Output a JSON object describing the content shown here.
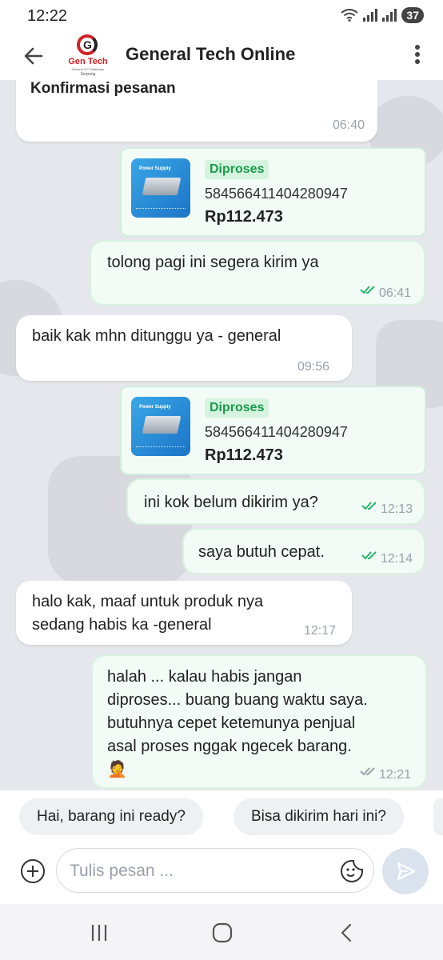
{
  "status": {
    "time": "12:22",
    "battery": "37"
  },
  "header": {
    "title": "General Tech Online",
    "logo": {
      "name": "Gen Tech",
      "tagline": "General ICT Distributor",
      "location": "Serpong",
      "mark": "G"
    }
  },
  "messages": [
    {
      "type": "in",
      "text": "Konfirmasi pesanan",
      "time": "06:40"
    },
    {
      "type": "product",
      "status": "Diproses",
      "order_id": "584566411404280947",
      "price": "Rp112.473",
      "thumb_title": "Power Supply"
    },
    {
      "type": "out",
      "text": "tolong pagi ini segera kirim ya",
      "time": "06:41",
      "read": true
    },
    {
      "type": "in",
      "text": "baik kak mhn ditunggu ya - general",
      "time": "09:56"
    },
    {
      "type": "product",
      "status": "Diproses",
      "order_id": "584566411404280947",
      "price": "Rp112.473",
      "thumb_title": "Power Supply"
    },
    {
      "type": "out",
      "text": "ini kok belum dikirim ya?",
      "time": "12:13",
      "read": true
    },
    {
      "type": "out",
      "text": "saya butuh cepat.",
      "time": "12:14",
      "read": true
    },
    {
      "type": "in",
      "line1": "halo kak, maaf untuk produk nya",
      "line2": "sedang habis ka -general",
      "time": "12:17"
    },
    {
      "type": "out",
      "line1": "halah ... kalau habis jangan",
      "line2": "diproses... buang buang waktu saya.",
      "line3": "butuhnya cepet ketemunya penjual",
      "line4": "asal proses nggak ngecek barang.",
      "emoji": "🤦",
      "time": "12:21",
      "read": false
    }
  ],
  "quick_replies": [
    "Hai, barang ini ready?",
    "Bisa dikirim hari ini?"
  ],
  "composer": {
    "placeholder": "Tulis pesan ..."
  },
  "colors": {
    "accent_green": "#1a9b4b",
    "read_tick": "#2bb673",
    "unread_tick": "#9aa1ab",
    "brand_red": "#d32027"
  },
  "icons": {
    "back": "arrow-left-icon",
    "more": "more-vertical-icon",
    "add": "plus-circle-icon",
    "sticker": "sticker-icon",
    "send": "send-icon",
    "nav_recents": "recents-icon",
    "nav_home": "home-icon",
    "nav_back": "nav-back-icon"
  }
}
